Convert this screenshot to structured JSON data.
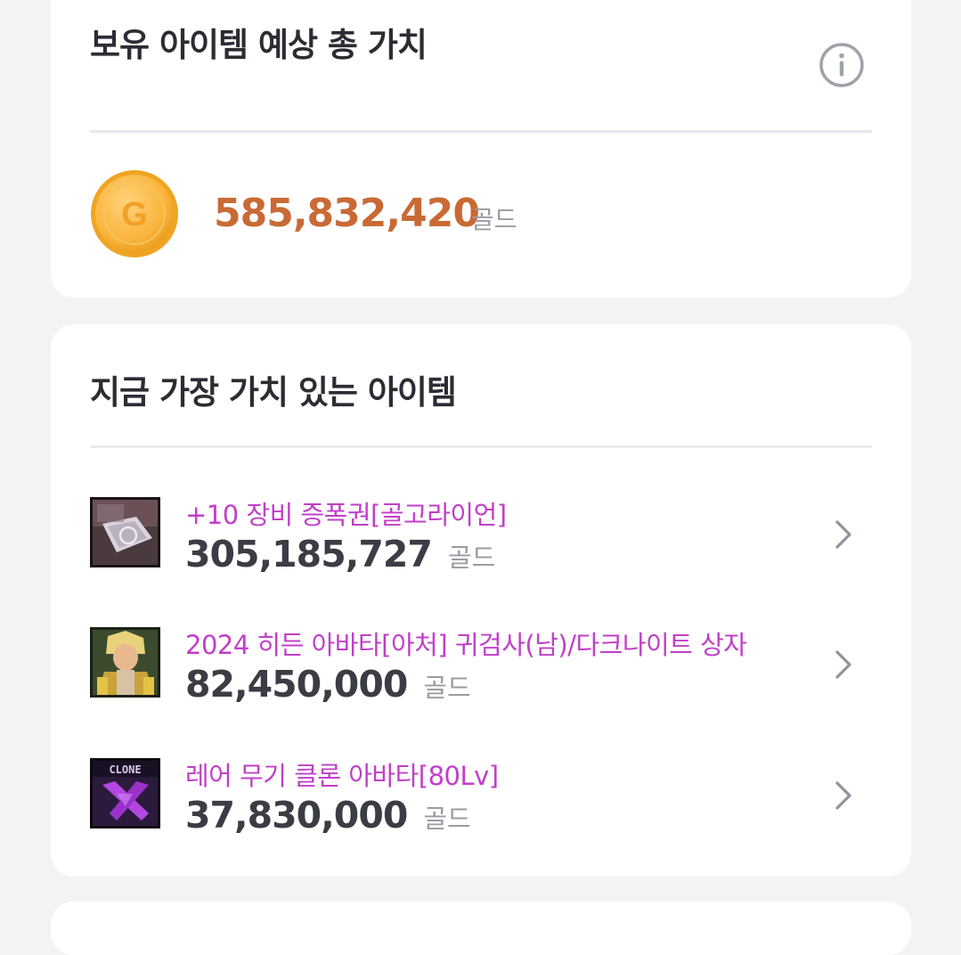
{
  "summary": {
    "title": "보유 아이템 예상 총 가치",
    "coin_letter": "G",
    "total_value": "585,832,420",
    "unit": "골드"
  },
  "top_items": {
    "title": "지금 가장 가치 있는 아이템",
    "items": [
      {
        "name": "+10 장비 증폭권[골고라이언]",
        "price": "305,185,727",
        "unit": "골드"
      },
      {
        "name": "2024 히든 아바타[아처] 귀검사(남)/다크나이트 상자",
        "price": "82,450,000",
        "unit": "골드"
      },
      {
        "name": "레어 무기 클론 아바타[80Lv]",
        "price": "37,830,000",
        "unit": "골드",
        "thumb_text": "CLONE"
      }
    ]
  },
  "colors": {
    "accent_value": "#c96a35",
    "item_name": "#c13fc8",
    "background": "#f2f3f5"
  }
}
